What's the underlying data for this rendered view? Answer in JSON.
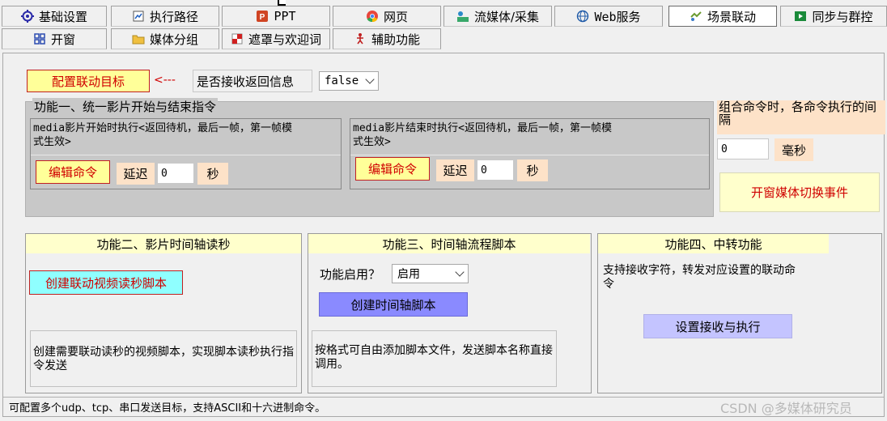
{
  "tabs_row1": [
    {
      "label": "基础设置",
      "icon": "gear-icon"
    },
    {
      "label": "执行路径",
      "icon": "path-icon"
    },
    {
      "label": "PPT",
      "icon": "powerpoint-icon"
    },
    {
      "label": "网页",
      "icon": "chrome-icon"
    },
    {
      "label": "流媒体/采集",
      "icon": "stream-icon"
    },
    {
      "label": "Web服务",
      "icon": "globe-icon"
    },
    {
      "label": "场景联动",
      "icon": "link-icon"
    },
    {
      "label": "同步与群控",
      "icon": "sync-icon"
    }
  ],
  "tabs_row2": [
    {
      "label": "开窗",
      "icon": "grid-icon"
    },
    {
      "label": "媒体分组",
      "icon": "folder-icon"
    },
    {
      "label": "遮罩与欢迎词",
      "icon": "mask-icon"
    },
    {
      "label": "辅助功能",
      "icon": "accessibility-icon"
    }
  ],
  "top": {
    "config_target_button": "配置联动目标",
    "arrow_text": "<---",
    "receive_label": "是否接收返回信息",
    "receive_value": "false"
  },
  "func1": {
    "title": "功能一、统一影片开始与结束指令",
    "start_desc": "media影片开始时执行<返回待机，最后一帧，第一帧模式生效>",
    "end_desc": "media影片结束时执行<返回待机，最后一帧，第一帧模式生效>",
    "edit_command": "编辑命令",
    "delay": "延迟",
    "delay_value_start": "0",
    "delay_value_end": "0",
    "seconds": "秒"
  },
  "combo": {
    "desc": "组合命令时，各命令执行的间隔",
    "value": "0",
    "unit": "毫秒",
    "switch_event_button": "开窗媒体切换事件"
  },
  "func2": {
    "title": "功能二、影片时间轴读秒",
    "button": "创建联动视频读秒脚本",
    "desc": "创建需要联动读秒的视频脚本，实现脚本读秒执行指令发送"
  },
  "func3": {
    "title": "功能三、时间轴流程脚本",
    "enable_label": "功能启用？",
    "enable_value": "启用",
    "button": "创建时间轴脚本",
    "desc": "按格式可自由添加脚本文件，发送脚本名称直接调用。"
  },
  "func4": {
    "title": "功能四、中转功能",
    "desc": "支持接收字符，转发对应设置的联动命令",
    "button": "设置接收与执行"
  },
  "status": "可配置多个udp、tcp、串口发送目标，支持ASCII和十六进制命令。",
  "watermark": "CSDN @多媒体研究员",
  "colors": {
    "yellow_button": "#ffff99",
    "red_text": "#cc0000",
    "peach": "#fde2c8",
    "cyan_button": "#8fffff",
    "blue_button": "#8a8aff",
    "lavender_button": "#c4c4ff",
    "light_yellow_header": "#ffffcc",
    "gray_panel": "#c8c8c8"
  }
}
